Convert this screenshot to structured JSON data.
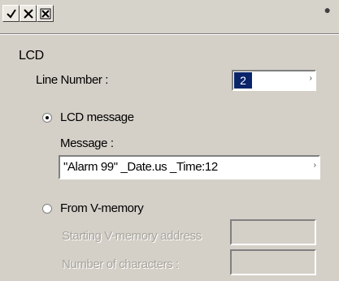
{
  "section_title": "LCD",
  "line_number": {
    "label": "Line Number :",
    "value": "2"
  },
  "lcd_message": {
    "label": "LCD message",
    "selected": true
  },
  "message": {
    "label": "Message :",
    "value": "\"Alarm 99\" _Date.us  _Time:12"
  },
  "from_v_memory": {
    "label": "From V-memory",
    "selected": false
  },
  "starting_address": {
    "label": "Starting V-memory address",
    "value": ""
  },
  "num_characters": {
    "label": "Number of characters :",
    "value": ""
  },
  "icons": {
    "check": "check-icon",
    "x": "x-icon",
    "x_alt": "close-box-icon",
    "close": "close-icon"
  }
}
